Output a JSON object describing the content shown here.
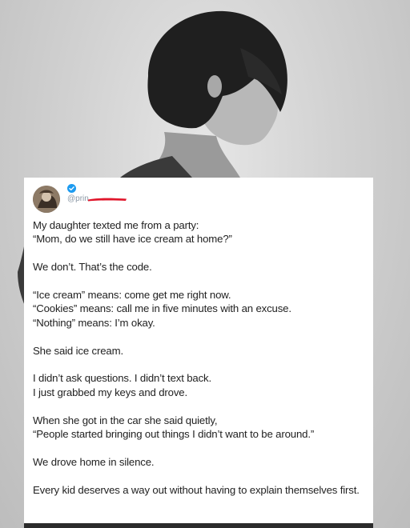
{
  "post": {
    "handle": "@prin",
    "verified_icon": "verified-badge-icon",
    "handle_redacted": true,
    "redaction_color": "#e0162b",
    "paragraphs": [
      "My daughter texted me from a party:\n“Mom, do we still have ice cream at home?”",
      "We don’t. That’s the code.",
      "“Ice cream” means: come get me right now.\n“Cookies” means: call me in five minutes with an excuse.\n“Nothing” means: I’m okay.",
      "She said ice cream.",
      "I didn’t ask questions. I didn’t text back.\nI just grabbed my keys and drove.",
      "When she got in the car she said quietly,\n“People started bringing out things I didn’t want to be around.”",
      "We drove home in silence.",
      "Every kid deserves a way out without having to explain themselves first."
    ]
  },
  "colors": {
    "verified_blue": "#1d9bf0",
    "card_background": "#ffffff",
    "text": "#222222",
    "handle_gray": "#8b98a5"
  }
}
